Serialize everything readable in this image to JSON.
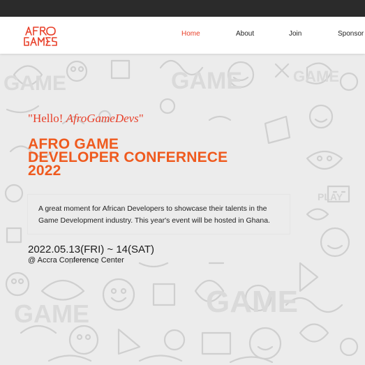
{
  "nav": {
    "logo_text": "AFRO GAMES",
    "items": [
      {
        "label": "Home",
        "active": true
      },
      {
        "label": "About",
        "active": false
      },
      {
        "label": "Join",
        "active": false
      },
      {
        "label": "Sponsor",
        "active": false
      }
    ]
  },
  "hero": {
    "greeting_prefix": "\"Hello! ",
    "greeting_italic": "AfroGameDevs",
    "greeting_suffix": "\"",
    "title_lines": [
      "AFRO GAME",
      "DEVELOPER CONFERNECE",
      "2022"
    ],
    "description": "A great moment for African Developers to showcase their talents in the Game Development industry. This year's event will be hosted in Ghana.",
    "date": "2022.05.13(FRI) ~ 14(SAT)",
    "venue": "@ Accra Conference Center"
  },
  "colors": {
    "accent": "#e8402a",
    "title": "#ef5a1e",
    "topbar": "#2b2b2b",
    "background": "#ececec"
  }
}
